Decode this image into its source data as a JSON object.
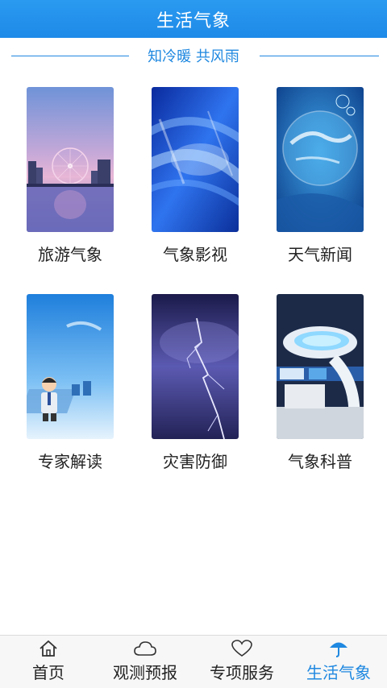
{
  "header": {
    "title": "生活气象"
  },
  "slogan": "知冷暖 共风雨",
  "tiles": [
    {
      "label": "旅游气象",
      "image": "ferris-wheel-city-night"
    },
    {
      "label": "气象影视",
      "image": "blue-abstract-swirl"
    },
    {
      "label": "天气新闻",
      "image": "glass-globe"
    },
    {
      "label": "专家解读",
      "image": "cartoon-expert-sky"
    },
    {
      "label": "灾害防御",
      "image": "lightning-storm"
    },
    {
      "label": "气象科普",
      "image": "weather-studio"
    }
  ],
  "tabbar": {
    "items": [
      {
        "label": "首页",
        "icon": "home-icon"
      },
      {
        "label": "观测预报",
        "icon": "cloud-icon"
      },
      {
        "label": "专项服务",
        "icon": "heart-icon"
      },
      {
        "label": "生活气象",
        "icon": "umbrella-icon"
      }
    ],
    "active_index": 3,
    "active_color": "#1f88e0"
  },
  "colors": {
    "header": "#1e8ae8",
    "accent": "#1f88e0"
  }
}
